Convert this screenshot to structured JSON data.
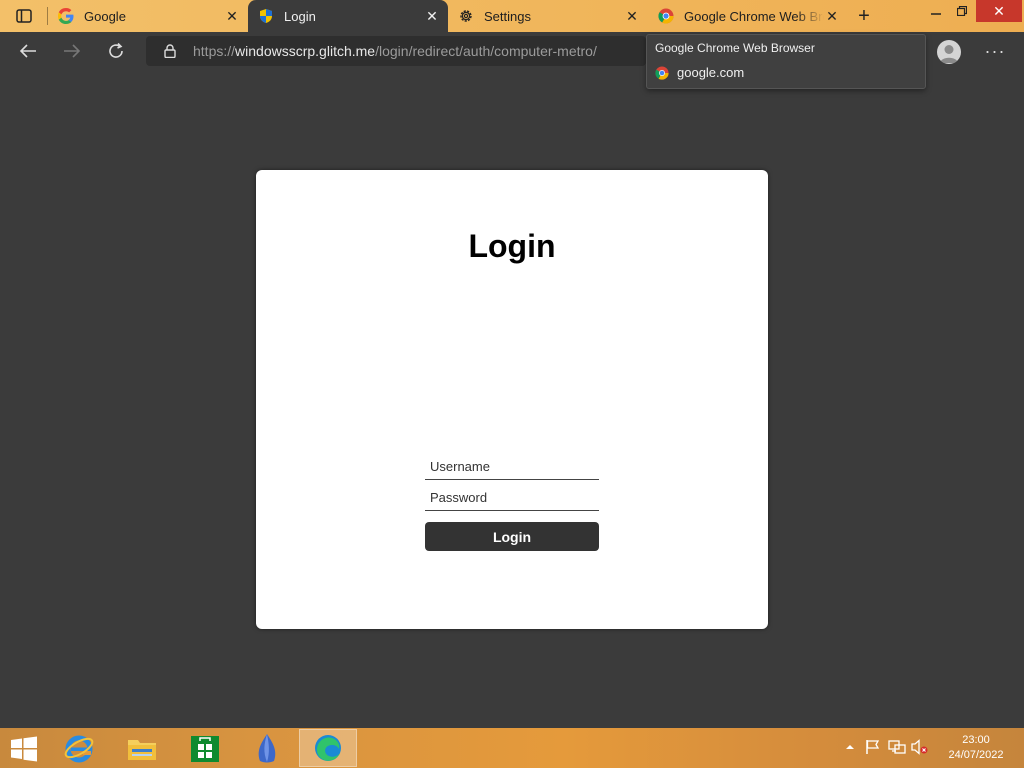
{
  "tabs": [
    {
      "title": "Google",
      "favicon": "google-g-icon"
    },
    {
      "title": "Login",
      "favicon": "shield-icon"
    },
    {
      "title": "Settings",
      "favicon": "gear-icon"
    },
    {
      "title": "Google Chrome Web Browser",
      "favicon": "chrome-icon"
    }
  ],
  "toolbar": {
    "url_prefix": "https://",
    "url_domain": "windowsscrp.glitch.me",
    "url_path": "/login/redirect/auth/computer-metro/"
  },
  "tooltip": {
    "title": "Google Chrome Web Browser",
    "url": "google.com"
  },
  "login": {
    "heading": "Login",
    "username_placeholder": "Username",
    "password_placeholder": "Password",
    "button_label": "Login"
  },
  "taskbar": {
    "apps": [
      "internet-explorer-icon",
      "file-explorer-icon",
      "store-icon",
      "metro-app-icon",
      "edge-icon"
    ],
    "time": "23:00",
    "date": "24/07/2022"
  },
  "colors": {
    "tabstrip": "#f0b55a",
    "page_bg": "#3b3b3b",
    "card_bg": "#ffffff",
    "button_bg": "#333333",
    "close_button": "#c7372b"
  }
}
